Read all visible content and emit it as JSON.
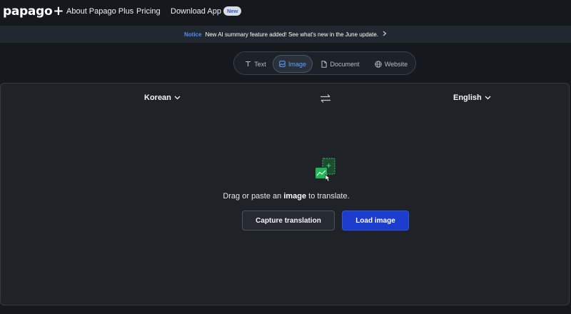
{
  "header": {
    "logo_text": "papago",
    "logo_suffix": "+",
    "nav": [
      {
        "label": "About Papago Plus"
      },
      {
        "label": "Pricing"
      },
      {
        "label": "Download App",
        "badge": "New"
      }
    ]
  },
  "notice": {
    "label": "Notice",
    "message": "New AI summary feature added! See what's new in the June update.",
    "icon": "chevron-right-icon"
  },
  "tabs": [
    {
      "label": "Text",
      "icon": "text-icon",
      "active": false
    },
    {
      "label": "Image",
      "icon": "image-icon",
      "active": true
    },
    {
      "label": "Document",
      "icon": "document-icon",
      "active": false
    },
    {
      "label": "Website",
      "icon": "globe-icon",
      "active": false
    }
  ],
  "translator": {
    "source_language": "Korean",
    "target_language": "English",
    "swap_icon": "swap-arrows-icon",
    "upload_icon": "image-upload-icon",
    "hint_prefix": "Drag or paste an ",
    "hint_bold": "image",
    "hint_suffix": " to translate.",
    "capture_button": "Capture translation",
    "load_button": "Load image"
  },
  "colors": {
    "background": "#15191e",
    "panel": "#1f2328",
    "accent_blue": "#1b3ccd",
    "active_tab_text": "#5fa2ff",
    "notice_label": "#4d8ef7",
    "icon_green": "#22b55a"
  }
}
